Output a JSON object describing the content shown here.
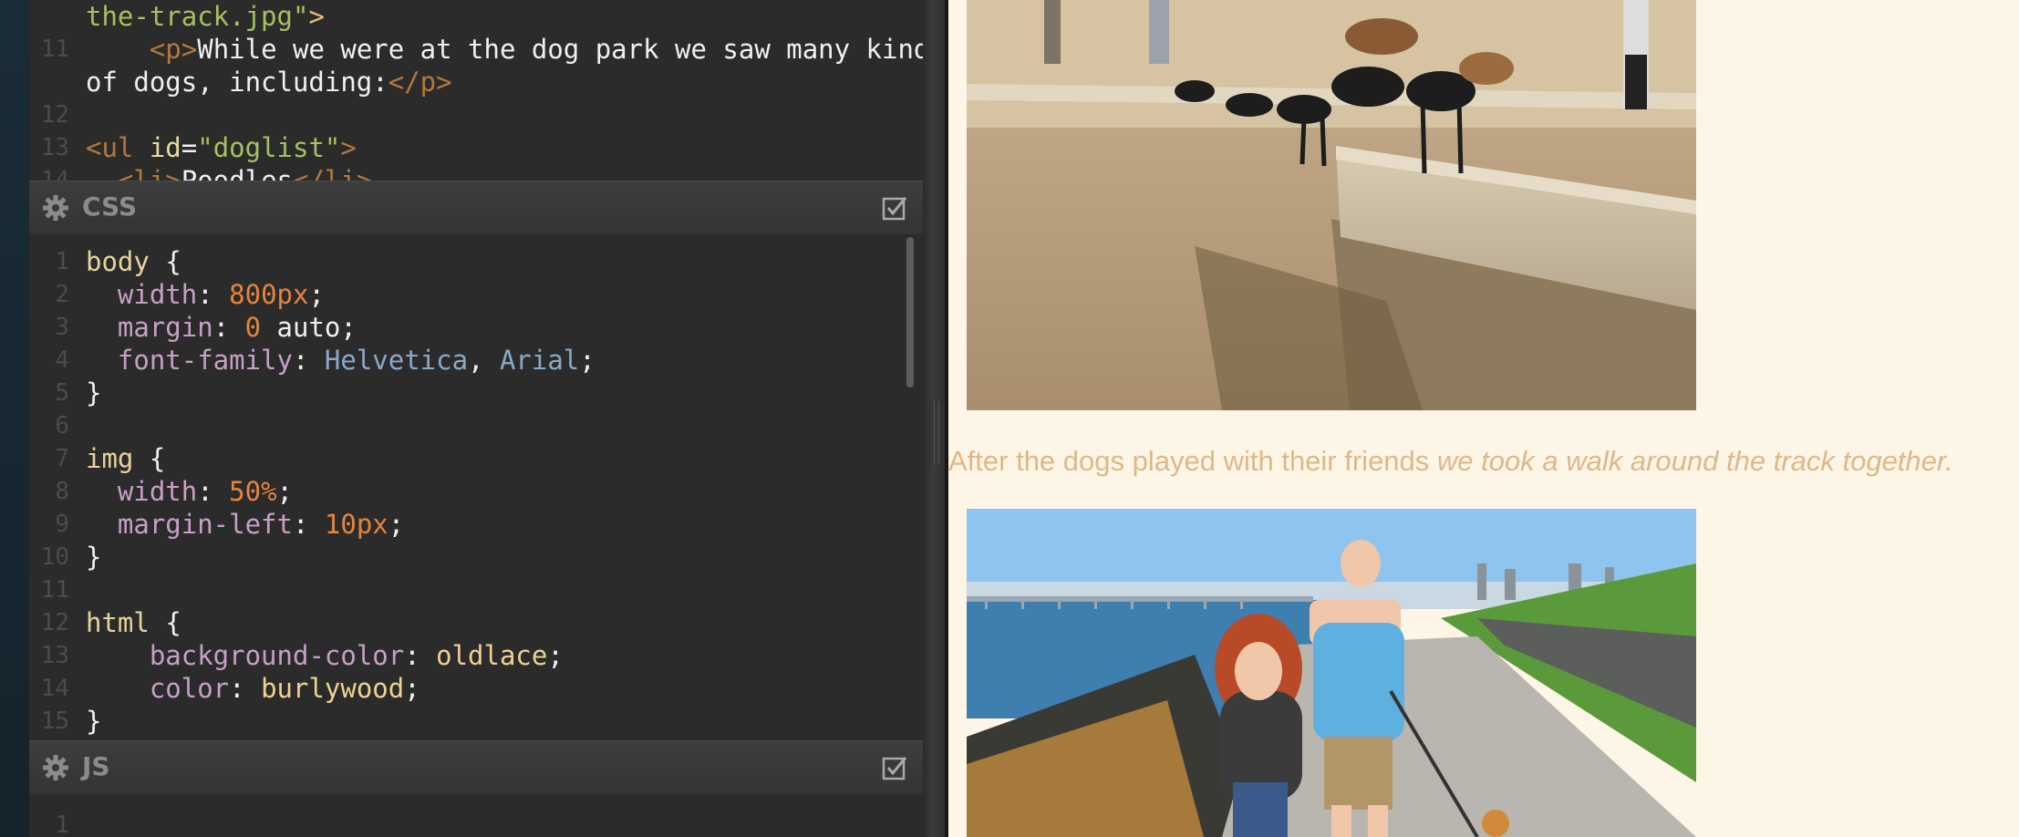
{
  "html_panel": {
    "lines": [
      {
        "n": "",
        "parts": [
          {
            "c": "str",
            "t": "the-track.jpg\""
          },
          {
            "c": "tag",
            "t": ">"
          }
        ]
      },
      {
        "n": "11",
        "parts": [
          {
            "c": "kw",
            "t": "    "
          },
          {
            "c": "tagb",
            "t": "<p>"
          },
          {
            "c": "kw",
            "t": "While we were at the dog park we saw many kinds"
          }
        ]
      },
      {
        "n": "",
        "parts": [
          {
            "c": "kw",
            "t": "of dogs, including:"
          },
          {
            "c": "tagb",
            "t": "</p>"
          }
        ]
      },
      {
        "n": "12",
        "parts": []
      },
      {
        "n": "13",
        "parts": [
          {
            "c": "tagb",
            "t": "<ul "
          },
          {
            "c": "attr",
            "t": "id"
          },
          {
            "c": "kw",
            "t": "="
          },
          {
            "c": "str",
            "t": "\"doglist\""
          },
          {
            "c": "tagb",
            "t": ">"
          }
        ]
      },
      {
        "n": "14",
        "parts": [
          {
            "c": "kw",
            "t": "  "
          },
          {
            "c": "tagb",
            "t": "<li>"
          },
          {
            "c": "kw",
            "t": "Poodles"
          },
          {
            "c": "tagb",
            "t": "</li>"
          }
        ]
      }
    ]
  },
  "css_panel": {
    "title": "CSS",
    "lines": [
      {
        "n": "1",
        "parts": [
          {
            "c": "sel",
            "t": "body "
          },
          {
            "c": "kw",
            "t": "{"
          }
        ]
      },
      {
        "n": "2",
        "parts": [
          {
            "c": "kw",
            "t": "  "
          },
          {
            "c": "prop",
            "t": "width"
          },
          {
            "c": "kw",
            "t": ": "
          },
          {
            "c": "num",
            "t": "800px"
          },
          {
            "c": "kw",
            "t": ";"
          }
        ]
      },
      {
        "n": "3",
        "parts": [
          {
            "c": "kw",
            "t": "  "
          },
          {
            "c": "prop",
            "t": "margin"
          },
          {
            "c": "kw",
            "t": ": "
          },
          {
            "c": "num",
            "t": "0"
          },
          {
            "c": "kw",
            "t": " auto;"
          }
        ]
      },
      {
        "n": "4",
        "parts": [
          {
            "c": "kw",
            "t": "  "
          },
          {
            "c": "prop",
            "t": "font-family"
          },
          {
            "c": "kw",
            "t": ": "
          },
          {
            "c": "val",
            "t": "Helvetica"
          },
          {
            "c": "kw",
            "t": ", "
          },
          {
            "c": "val",
            "t": "Arial"
          },
          {
            "c": "kw",
            "t": ";"
          }
        ]
      },
      {
        "n": "5",
        "parts": [
          {
            "c": "kw",
            "t": "}"
          }
        ]
      },
      {
        "n": "6",
        "parts": []
      },
      {
        "n": "7",
        "parts": [
          {
            "c": "sel",
            "t": "img "
          },
          {
            "c": "kw",
            "t": "{"
          }
        ]
      },
      {
        "n": "8",
        "parts": [
          {
            "c": "kw",
            "t": "  "
          },
          {
            "c": "prop",
            "t": "width"
          },
          {
            "c": "kw",
            "t": ": "
          },
          {
            "c": "num",
            "t": "50%"
          },
          {
            "c": "kw",
            "t": ";"
          }
        ]
      },
      {
        "n": "9",
        "parts": [
          {
            "c": "kw",
            "t": "  "
          },
          {
            "c": "prop",
            "t": "margin-left"
          },
          {
            "c": "kw",
            "t": ": "
          },
          {
            "c": "num",
            "t": "10px"
          },
          {
            "c": "kw",
            "t": ";"
          }
        ]
      },
      {
        "n": "10",
        "parts": [
          {
            "c": "kw",
            "t": "}"
          }
        ]
      },
      {
        "n": "11",
        "parts": []
      },
      {
        "n": "12",
        "parts": [
          {
            "c": "sel",
            "t": "html "
          },
          {
            "c": "kw",
            "t": "{"
          }
        ]
      },
      {
        "n": "13",
        "parts": [
          {
            "c": "kw",
            "t": "    "
          },
          {
            "c": "prop",
            "t": "background-color"
          },
          {
            "c": "kw",
            "t": ": "
          },
          {
            "c": "lit",
            "t": "oldlace"
          },
          {
            "c": "kw",
            "t": ";"
          }
        ]
      },
      {
        "n": "14",
        "parts": [
          {
            "c": "kw",
            "t": "    "
          },
          {
            "c": "prop",
            "t": "color"
          },
          {
            "c": "kw",
            "t": ": "
          },
          {
            "c": "lit",
            "t": "burlywood"
          },
          {
            "c": "kw",
            "t": ";"
          }
        ]
      },
      {
        "n": "15",
        "parts": [
          {
            "c": "kw",
            "t": "}"
          }
        ]
      }
    ]
  },
  "js_panel": {
    "title": "JS",
    "lines": [
      {
        "n": "1",
        "parts": []
      }
    ]
  },
  "preview": {
    "paragraph_plain": "After the dogs played with their friends ",
    "paragraph_italic": "we took a walk around the track together."
  },
  "colors": {
    "preview_background": "#fdf5e6",
    "preview_text": "#deb887",
    "editor_background": "#2b2b2c"
  },
  "icons": {
    "panel_settings": "gear-icon",
    "panel_toggle": "checkbox-icon"
  }
}
